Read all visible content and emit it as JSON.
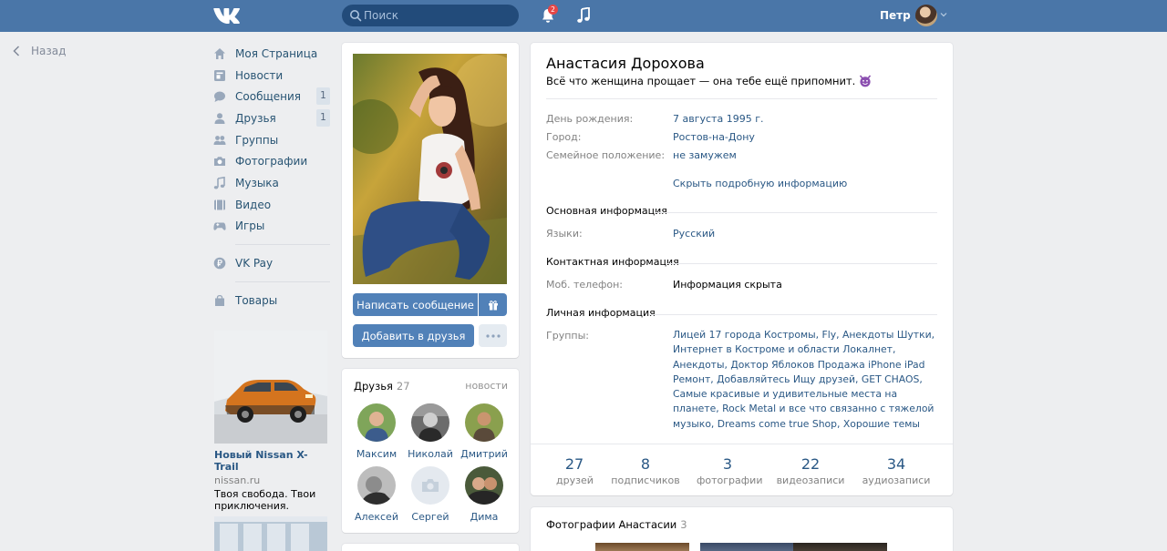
{
  "header": {
    "search_placeholder": "Поиск",
    "notification_count": "2",
    "user_name": "Петр"
  },
  "back_label": "Назад",
  "sidebar": {
    "items": [
      {
        "label": "Моя Страница",
        "icon": "home-icon"
      },
      {
        "label": "Новости",
        "icon": "news-icon"
      },
      {
        "label": "Сообщения",
        "icon": "messages-icon",
        "count": "1"
      },
      {
        "label": "Друзья",
        "icon": "friends-icon",
        "count": "1"
      },
      {
        "label": "Группы",
        "icon": "groups-icon"
      },
      {
        "label": "Фотографии",
        "icon": "camera-icon"
      },
      {
        "label": "Музыка",
        "icon": "music-icon"
      },
      {
        "label": "Видео",
        "icon": "video-icon"
      },
      {
        "label": "Игры",
        "icon": "games-icon"
      }
    ],
    "vkpay": "VK Pay",
    "goods": "Товары"
  },
  "ad": {
    "title": "Новый Nissan X-Trail",
    "domain": "nissan.ru",
    "text": "Твоя свобода. Твои приключения."
  },
  "photo_card": {
    "message_button": "Написать сообщение",
    "add_friend_button": "Добавить в друзья"
  },
  "friends": {
    "title": "Друзья",
    "count": "27",
    "news_link": "новости",
    "items": [
      {
        "name": "Максим"
      },
      {
        "name": "Николай"
      },
      {
        "name": "Дмитрий"
      },
      {
        "name": "Алексей"
      },
      {
        "name": "Сергей"
      },
      {
        "name": "Дима"
      }
    ]
  },
  "profile": {
    "name": "Анастасия Дорохова",
    "status": "Всё что женщина прощает — она тебе ещё припомнит.",
    "rows": [
      {
        "label": "День рождения:",
        "value": "7 августа 1995 г."
      },
      {
        "label": "Город:",
        "value": "Ростов-на-Дону"
      },
      {
        "label": "Семейное положение:",
        "value": "не замужем"
      }
    ],
    "hide_details": "Скрыть подробную информацию",
    "section_main": "Основная информация",
    "languages_label": "Языки:",
    "languages_value": "Русский",
    "section_contact": "Контактная информация",
    "phone_label": "Моб. телефон:",
    "phone_value": "Информация скрыта",
    "section_personal": "Личная информация",
    "groups_label": "Группы:",
    "groups_value": "Лицей 17 города Костромы, Fly, Анекдоты Шутки, Интернет в Костроме и области Локалнет, Анекдоты, Доктор Яблоков Продажа iPhone iPad Ремонт, Добавляйтесь Ищу друзей, GET CHAOS, Самые красивые и удивительные места на планете, Rock Metal и все что связанно с тяжелой музыко, Dreams come true Shop, Хорошие темы",
    "stats": [
      {
        "num": "27",
        "label": "друзей"
      },
      {
        "num": "8",
        "label": "подписчиков"
      },
      {
        "num": "3",
        "label": "фотографии"
      },
      {
        "num": "22",
        "label": "видеозаписи"
      },
      {
        "num": "34",
        "label": "аудиозаписи"
      }
    ]
  },
  "photos": {
    "title": "Фотографии Анастасии",
    "count": "3"
  }
}
